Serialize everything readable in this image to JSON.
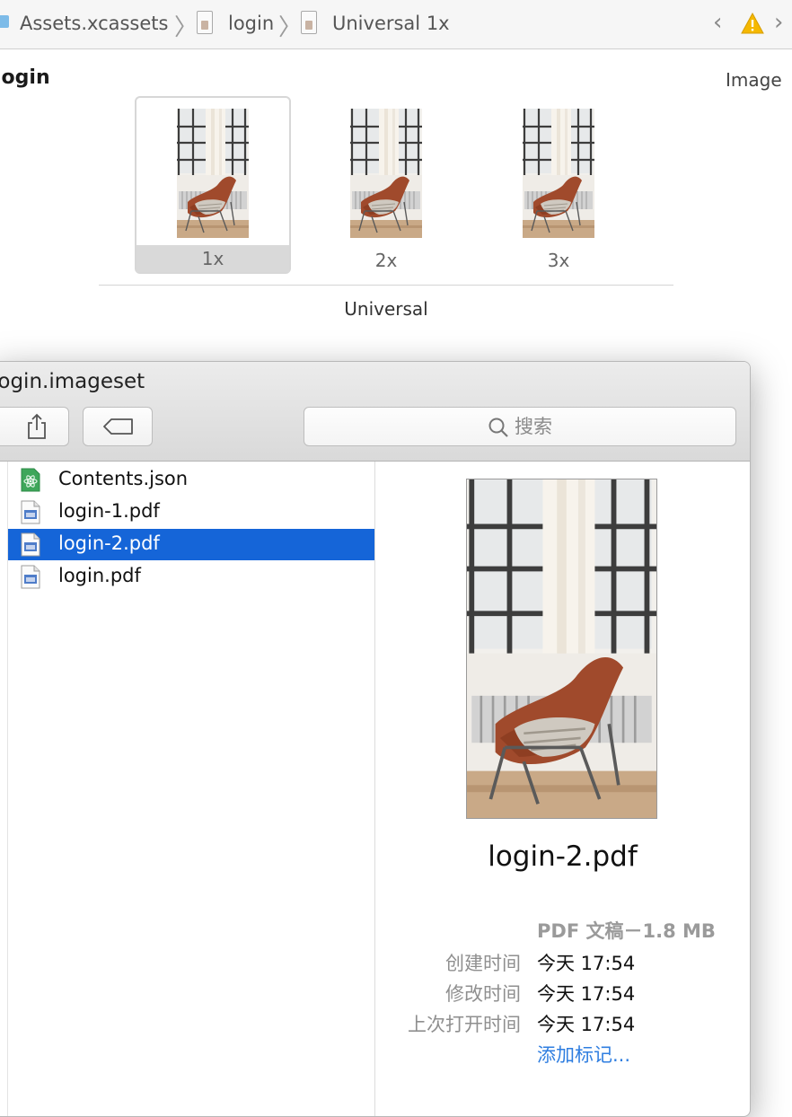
{
  "breadcrumb": {
    "items": [
      "Assets.xcassets",
      "login",
      "Universal 1x"
    ]
  },
  "asset_editor": {
    "asset_name": "login",
    "inspector_label": "Image",
    "slots": [
      {
        "label": "1x",
        "selected": true
      },
      {
        "label": "2x",
        "selected": false
      },
      {
        "label": "3x",
        "selected": false
      }
    ],
    "group_label": "Universal"
  },
  "finder": {
    "window_title": "login.imageset",
    "search": {
      "placeholder": "搜索",
      "icon": "magnifier-icon"
    },
    "files": [
      {
        "name": "Contents.json",
        "icon": "json-file-icon",
        "selected": false
      },
      {
        "name": "login-1.pdf",
        "icon": "pdf-file-icon",
        "selected": false
      },
      {
        "name": "login-2.pdf",
        "icon": "pdf-file-icon",
        "selected": true
      },
      {
        "name": "login.pdf",
        "icon": "pdf-file-icon",
        "selected": false
      }
    ],
    "preview": {
      "file_name": "login-2.pdf",
      "kind_size": "PDF 文稿－1.8 MB",
      "meta": [
        {
          "key": "创建时间",
          "value": "今天 17:54"
        },
        {
          "key": "修改时间",
          "value": "今天 17:54"
        },
        {
          "key": "上次打开时间",
          "value": "今天 17:54"
        }
      ],
      "add_tags": "添加标记..."
    }
  },
  "colors": {
    "selection": "#1565d8",
    "link": "#2f7ee0",
    "warning": "#f5b800"
  }
}
